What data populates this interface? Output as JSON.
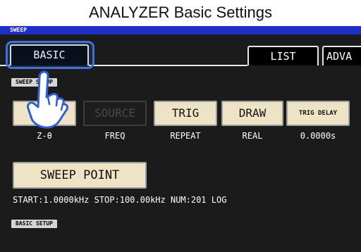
{
  "caption": "ANALYZER Basic Settings",
  "header": {
    "mode_label": "SWEEP"
  },
  "tabs": {
    "basic": "BASIC",
    "list": "LIST",
    "advanced": "ADVA"
  },
  "sections": {
    "sweep_setup": "SWEEP SETUP",
    "basic_setup": "BASIC SETUP"
  },
  "buttons": {
    "para": "PARA",
    "source": "SOURCE",
    "trig": "TRIG",
    "draw": "DRAW",
    "trig_delay": "TRIG DELAY",
    "sweep_point": "SWEEP POINT"
  },
  "values": {
    "para": "Z-θ",
    "source": "FREQ",
    "trig": "REPEAT",
    "draw": "REAL",
    "trig_delay": "0.0000s"
  },
  "sweep_info": "START:1.0000kHz STOP:100.00kHz NUM:201 LOG",
  "colors": {
    "header_bar": "#1e2fc8",
    "button_bg": "#efe3c6",
    "highlight": "#3f6fe0"
  }
}
